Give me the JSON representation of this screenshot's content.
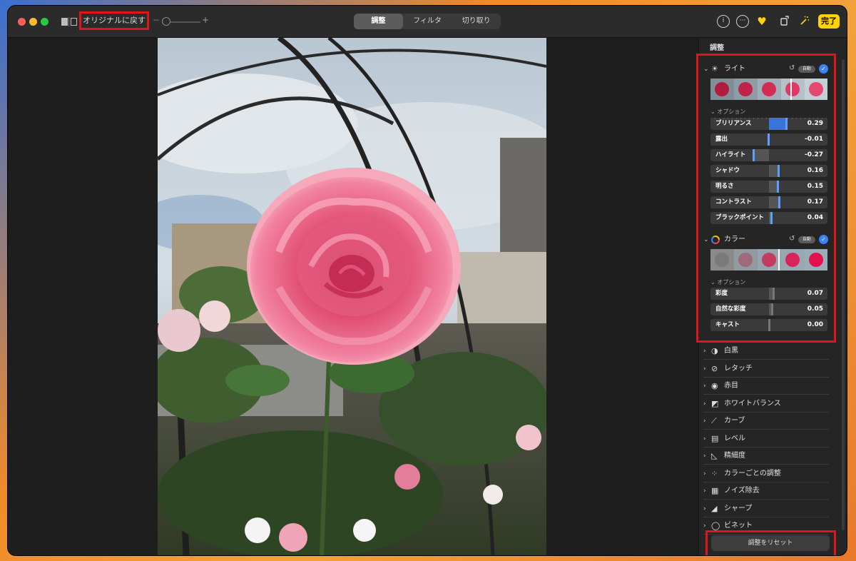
{
  "toolbar": {
    "revert_label": "オリジナルに戻す",
    "zoom_minus": "−",
    "zoom_plus": "+",
    "tabs": [
      {
        "label": "調整",
        "active": true
      },
      {
        "label": "フィルタ",
        "active": false
      },
      {
        "label": "切り取り",
        "active": false
      }
    ],
    "right_icons": [
      "info-icon",
      "more-icon",
      "heart-icon",
      "rotate-icon",
      "magic-wand-icon"
    ],
    "done_label": "完了",
    "done_color": "#ffd30a"
  },
  "sidebar": {
    "title": "調整",
    "light": {
      "label": "ライト",
      "auto": "自動",
      "options_label": "オプション",
      "sliders": [
        {
          "label": "ブリリアンス",
          "value": "0.29",
          "v": 0.29
        },
        {
          "label": "露出",
          "value": "-0.01",
          "v": -0.01
        },
        {
          "label": "ハイライト",
          "value": "-0.27",
          "v": -0.27
        },
        {
          "label": "シャドウ",
          "value": "0.16",
          "v": 0.16
        },
        {
          "label": "明るさ",
          "value": "0.15",
          "v": 0.15
        },
        {
          "label": "コントラスト",
          "value": "0.17",
          "v": 0.17
        },
        {
          "label": "ブラックポイント",
          "value": "0.04",
          "v": 0.04
        }
      ]
    },
    "color": {
      "label": "カラー",
      "auto": "自動",
      "options_label": "オプション",
      "sliders": [
        {
          "label": "彩度",
          "value": "0.07",
          "v": 0.07
        },
        {
          "label": "自然な彩度",
          "value": "0.05",
          "v": 0.05
        },
        {
          "label": "キャスト",
          "value": "0.00",
          "v": 0.0
        }
      ]
    },
    "tools": [
      {
        "label": "白黒",
        "icon": "half-circle-icon"
      },
      {
        "label": "レタッチ",
        "icon": "bandage-icon"
      },
      {
        "label": "赤目",
        "icon": "eye-icon"
      },
      {
        "label": "ホワイトバランス",
        "icon": "white-balance-icon"
      },
      {
        "label": "カーブ",
        "icon": "curves-icon"
      },
      {
        "label": "レベル",
        "icon": "levels-icon"
      },
      {
        "label": "精細度",
        "icon": "definition-icon"
      },
      {
        "label": "カラーごとの調整",
        "icon": "selective-color-icon"
      },
      {
        "label": "ノイズ除去",
        "icon": "noise-reduction-icon"
      },
      {
        "label": "シャープ",
        "icon": "sharpen-icon"
      },
      {
        "label": "ビネット",
        "icon": "vignette-icon"
      }
    ],
    "reset_label": "調整をリセット"
  }
}
